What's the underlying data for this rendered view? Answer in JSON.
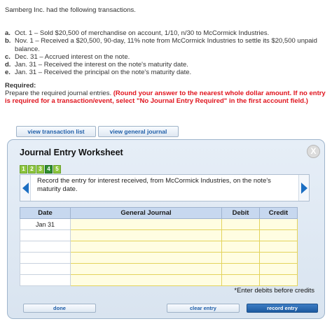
{
  "intro": "Samberg Inc. had the following transactions.",
  "transactions": [
    {
      "letter": "a.",
      "text": "Oct. 1 – Sold $20,500 of merchandise on account, 1/10, n/30 to McCormick Industries."
    },
    {
      "letter": "b.",
      "text": "Nov. 1 – Received a $20,500, 90-day, 11% note from McCormick Industries to settle its $20,500 unpaid balance."
    },
    {
      "letter": "c.",
      "text": "Dec. 31 – Accrued interest on the note."
    },
    {
      "letter": "d.",
      "text": "Jan. 31 – Received the interest on the note's maturity date."
    },
    {
      "letter": "e.",
      "text": "Jan. 31 – Received the principal on the note's maturity date."
    }
  ],
  "required": {
    "heading": "Required:",
    "text": "Prepare the required journal entries.",
    "note": "(Round your answer to the nearest whole dollar amount. If no entry is required for a transaction/event, select \"No Journal Entry Required\" in the first account field.)"
  },
  "buttons": {
    "view_transaction_list": "view transaction list",
    "view_general_journal": "view general journal",
    "done": "done",
    "clear_entry": "clear entry",
    "record_entry": "record entry"
  },
  "worksheet": {
    "title": "Journal Entry Worksheet",
    "close": "X",
    "steps": [
      "1",
      "2",
      "3",
      "4",
      "5"
    ],
    "active_step": "4",
    "prompt": "Record the entry for interest received, from McCormick Industries, on the note's maturity date.",
    "columns": [
      "Date",
      "General Journal",
      "Debit",
      "Credit"
    ],
    "rows": [
      {
        "date": "Jan 31",
        "account": "",
        "debit": "",
        "credit": ""
      },
      {
        "date": "",
        "account": "",
        "debit": "",
        "credit": ""
      },
      {
        "date": "",
        "account": "",
        "debit": "",
        "credit": ""
      },
      {
        "date": "",
        "account": "",
        "debit": "",
        "credit": ""
      },
      {
        "date": "",
        "account": "",
        "debit": "",
        "credit": ""
      },
      {
        "date": "",
        "account": "",
        "debit": "",
        "credit": ""
      }
    ],
    "footer_note": "*Enter debits before credits"
  }
}
